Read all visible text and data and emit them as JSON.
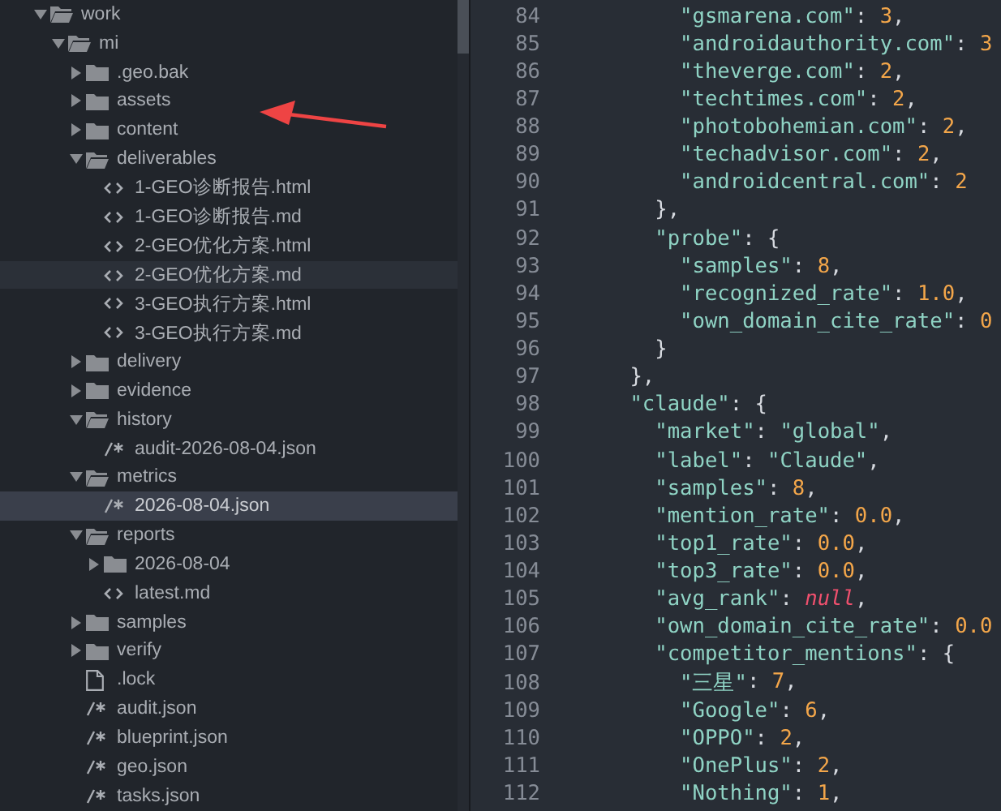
{
  "sidebar": {
    "tree": [
      {
        "label": "work",
        "kind": "folder",
        "expanded": true,
        "selected": false,
        "highlighted": false,
        "children": [
          {
            "label": "mi",
            "kind": "folder",
            "expanded": true,
            "selected": false,
            "highlighted": false,
            "children": [
              {
                "label": ".geo.bak",
                "kind": "folder",
                "expanded": false,
                "selected": false,
                "highlighted": false
              },
              {
                "label": "assets",
                "kind": "folder",
                "expanded": false,
                "selected": false,
                "highlighted": false
              },
              {
                "label": "content",
                "kind": "folder",
                "expanded": false,
                "selected": false,
                "highlighted": false
              },
              {
                "label": "deliverables",
                "kind": "folder",
                "expanded": true,
                "selected": false,
                "highlighted": false,
                "children": [
                  {
                    "label": "1-GEO诊断报告.html",
                    "kind": "markup",
                    "selected": false,
                    "highlighted": false
                  },
                  {
                    "label": "1-GEO诊断报告.md",
                    "kind": "markup",
                    "selected": false,
                    "highlighted": false
                  },
                  {
                    "label": "2-GEO优化方案.html",
                    "kind": "markup",
                    "selected": false,
                    "highlighted": false
                  },
                  {
                    "label": "2-GEO优化方案.md",
                    "kind": "markup",
                    "selected": false,
                    "highlighted": true
                  },
                  {
                    "label": "3-GEO执行方案.html",
                    "kind": "markup",
                    "selected": false,
                    "highlighted": false
                  },
                  {
                    "label": "3-GEO执行方案.md",
                    "kind": "markup",
                    "selected": false,
                    "highlighted": false
                  }
                ]
              },
              {
                "label": "delivery",
                "kind": "folder",
                "expanded": false,
                "selected": false,
                "highlighted": false
              },
              {
                "label": "evidence",
                "kind": "folder",
                "expanded": false,
                "selected": false,
                "highlighted": false
              },
              {
                "label": "history",
                "kind": "folder",
                "expanded": true,
                "selected": false,
                "highlighted": false,
                "children": [
                  {
                    "label": "audit-2026-08-04.json",
                    "kind": "json",
                    "selected": false,
                    "highlighted": false
                  }
                ]
              },
              {
                "label": "metrics",
                "kind": "folder",
                "expanded": true,
                "selected": false,
                "highlighted": false,
                "children": [
                  {
                    "label": "2026-08-04.json",
                    "kind": "json",
                    "selected": true,
                    "highlighted": false
                  }
                ]
              },
              {
                "label": "reports",
                "kind": "folder",
                "expanded": true,
                "selected": false,
                "highlighted": false,
                "children": [
                  {
                    "label": "2026-08-04",
                    "kind": "folder",
                    "expanded": false,
                    "selected": false,
                    "highlighted": false
                  },
                  {
                    "label": "latest.md",
                    "kind": "markup",
                    "selected": false,
                    "highlighted": false
                  }
                ]
              },
              {
                "label": "samples",
                "kind": "folder",
                "expanded": false,
                "selected": false,
                "highlighted": false
              },
              {
                "label": "verify",
                "kind": "folder",
                "expanded": false,
                "selected": false,
                "highlighted": false
              },
              {
                "label": ".lock",
                "kind": "plain",
                "selected": false,
                "highlighted": false
              },
              {
                "label": "audit.json",
                "kind": "json",
                "selected": false,
                "highlighted": false
              },
              {
                "label": "blueprint.json",
                "kind": "json",
                "selected": false,
                "highlighted": false
              },
              {
                "label": "geo.json",
                "kind": "json",
                "selected": false,
                "highlighted": false
              },
              {
                "label": "tasks.json",
                "kind": "json",
                "selected": false,
                "highlighted": false
              }
            ]
          }
        ]
      }
    ]
  },
  "editor": {
    "lines": [
      {
        "number": "84",
        "tokens": [
          {
            "kind": "key",
            "text": "          \"gsmarena.com\""
          },
          {
            "kind": "punct",
            "text": ": "
          },
          {
            "kind": "number",
            "text": "3"
          },
          {
            "kind": "punct",
            "text": ","
          }
        ]
      },
      {
        "number": "85",
        "tokens": [
          {
            "kind": "key",
            "text": "          \"androidauthority.com\""
          },
          {
            "kind": "punct",
            "text": ": "
          },
          {
            "kind": "number",
            "text": "3"
          }
        ]
      },
      {
        "number": "86",
        "tokens": [
          {
            "kind": "key",
            "text": "          \"theverge.com\""
          },
          {
            "kind": "punct",
            "text": ": "
          },
          {
            "kind": "number",
            "text": "2"
          },
          {
            "kind": "punct",
            "text": ","
          }
        ]
      },
      {
        "number": "87",
        "tokens": [
          {
            "kind": "key",
            "text": "          \"techtimes.com\""
          },
          {
            "kind": "punct",
            "text": ": "
          },
          {
            "kind": "number",
            "text": "2"
          },
          {
            "kind": "punct",
            "text": ","
          }
        ]
      },
      {
        "number": "88",
        "tokens": [
          {
            "kind": "key",
            "text": "          \"photobohemian.com\""
          },
          {
            "kind": "punct",
            "text": ": "
          },
          {
            "kind": "number",
            "text": "2"
          },
          {
            "kind": "punct",
            "text": ","
          }
        ]
      },
      {
        "number": "89",
        "tokens": [
          {
            "kind": "key",
            "text": "          \"techadvisor.com\""
          },
          {
            "kind": "punct",
            "text": ": "
          },
          {
            "kind": "number",
            "text": "2"
          },
          {
            "kind": "punct",
            "text": ","
          }
        ]
      },
      {
        "number": "90",
        "tokens": [
          {
            "kind": "key",
            "text": "          \"androidcentral.com\""
          },
          {
            "kind": "punct",
            "text": ": "
          },
          {
            "kind": "number",
            "text": "2"
          }
        ]
      },
      {
        "number": "91",
        "tokens": [
          {
            "kind": "punct",
            "text": "        },"
          }
        ]
      },
      {
        "number": "92",
        "tokens": [
          {
            "kind": "key",
            "text": "        \"probe\""
          },
          {
            "kind": "punct",
            "text": ": {"
          }
        ]
      },
      {
        "number": "93",
        "tokens": [
          {
            "kind": "key",
            "text": "          \"samples\""
          },
          {
            "kind": "punct",
            "text": ": "
          },
          {
            "kind": "number",
            "text": "8"
          },
          {
            "kind": "punct",
            "text": ","
          }
        ]
      },
      {
        "number": "94",
        "tokens": [
          {
            "kind": "key",
            "text": "          \"recognized_rate\""
          },
          {
            "kind": "punct",
            "text": ": "
          },
          {
            "kind": "number",
            "text": "1.0"
          },
          {
            "kind": "punct",
            "text": ","
          }
        ]
      },
      {
        "number": "95",
        "tokens": [
          {
            "kind": "key",
            "text": "          \"own_domain_cite_rate\""
          },
          {
            "kind": "punct",
            "text": ": "
          },
          {
            "kind": "number",
            "text": "0"
          }
        ]
      },
      {
        "number": "96",
        "tokens": [
          {
            "kind": "punct",
            "text": "        }"
          }
        ]
      },
      {
        "number": "97",
        "tokens": [
          {
            "kind": "punct",
            "text": "      },"
          }
        ]
      },
      {
        "number": "98",
        "tokens": [
          {
            "kind": "key",
            "text": "      \"claude\""
          },
          {
            "kind": "punct",
            "text": ": {"
          }
        ]
      },
      {
        "number": "99",
        "tokens": [
          {
            "kind": "key",
            "text": "        \"market\""
          },
          {
            "kind": "punct",
            "text": ": "
          },
          {
            "kind": "string",
            "text": "\"global\""
          },
          {
            "kind": "punct",
            "text": ","
          }
        ]
      },
      {
        "number": "100",
        "tokens": [
          {
            "kind": "key",
            "text": "        \"label\""
          },
          {
            "kind": "punct",
            "text": ": "
          },
          {
            "kind": "string",
            "text": "\"Claude\""
          },
          {
            "kind": "punct",
            "text": ","
          }
        ]
      },
      {
        "number": "101",
        "tokens": [
          {
            "kind": "key",
            "text": "        \"samples\""
          },
          {
            "kind": "punct",
            "text": ": "
          },
          {
            "kind": "number",
            "text": "8"
          },
          {
            "kind": "punct",
            "text": ","
          }
        ]
      },
      {
        "number": "102",
        "tokens": [
          {
            "kind": "key",
            "text": "        \"mention_rate\""
          },
          {
            "kind": "punct",
            "text": ": "
          },
          {
            "kind": "number",
            "text": "0.0"
          },
          {
            "kind": "punct",
            "text": ","
          }
        ]
      },
      {
        "number": "103",
        "tokens": [
          {
            "kind": "key",
            "text": "        \"top1_rate\""
          },
          {
            "kind": "punct",
            "text": ": "
          },
          {
            "kind": "number",
            "text": "0.0"
          },
          {
            "kind": "punct",
            "text": ","
          }
        ]
      },
      {
        "number": "104",
        "tokens": [
          {
            "kind": "key",
            "text": "        \"top3_rate\""
          },
          {
            "kind": "punct",
            "text": ": "
          },
          {
            "kind": "number",
            "text": "0.0"
          },
          {
            "kind": "punct",
            "text": ","
          }
        ]
      },
      {
        "number": "105",
        "tokens": [
          {
            "kind": "key",
            "text": "        \"avg_rank\""
          },
          {
            "kind": "punct",
            "text": ": "
          },
          {
            "kind": "null",
            "text": "null"
          },
          {
            "kind": "punct",
            "text": ","
          }
        ]
      },
      {
        "number": "106",
        "tokens": [
          {
            "kind": "key",
            "text": "        \"own_domain_cite_rate\""
          },
          {
            "kind": "punct",
            "text": ": "
          },
          {
            "kind": "number",
            "text": "0.0"
          }
        ]
      },
      {
        "number": "107",
        "tokens": [
          {
            "kind": "key",
            "text": "        \"competitor_mentions\""
          },
          {
            "kind": "punct",
            "text": ": {"
          }
        ]
      },
      {
        "number": "108",
        "tokens": [
          {
            "kind": "key",
            "text": "          \"三星\""
          },
          {
            "kind": "punct",
            "text": ": "
          },
          {
            "kind": "number",
            "text": "7"
          },
          {
            "kind": "punct",
            "text": ","
          }
        ]
      },
      {
        "number": "109",
        "tokens": [
          {
            "kind": "key",
            "text": "          \"Google\""
          },
          {
            "kind": "punct",
            "text": ": "
          },
          {
            "kind": "number",
            "text": "6"
          },
          {
            "kind": "punct",
            "text": ","
          }
        ]
      },
      {
        "number": "110",
        "tokens": [
          {
            "kind": "key",
            "text": "          \"OPPO\""
          },
          {
            "kind": "punct",
            "text": ": "
          },
          {
            "kind": "number",
            "text": "2"
          },
          {
            "kind": "punct",
            "text": ","
          }
        ]
      },
      {
        "number": "111",
        "tokens": [
          {
            "kind": "key",
            "text": "          \"OnePlus\""
          },
          {
            "kind": "punct",
            "text": ": "
          },
          {
            "kind": "number",
            "text": "2"
          },
          {
            "kind": "punct",
            "text": ","
          }
        ]
      },
      {
        "number": "112",
        "tokens": [
          {
            "kind": "key",
            "text": "          \"Nothing\""
          },
          {
            "kind": "punct",
            "text": ": "
          },
          {
            "kind": "number",
            "text": "1"
          },
          {
            "kind": "punct",
            "text": ","
          }
        ]
      }
    ]
  }
}
